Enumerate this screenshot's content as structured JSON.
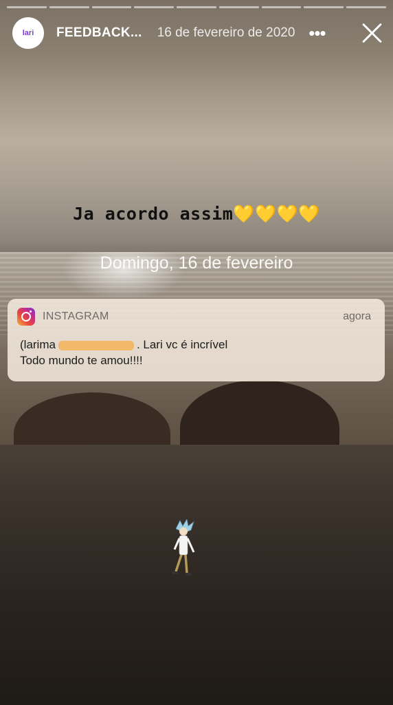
{
  "story": {
    "segments": 9,
    "username": "FEEDBACK...",
    "date": "16 de fevereiro de 2020",
    "avatar_text": "lari",
    "caption": "Ja acordo assim",
    "caption_emoji": "💛💛💛💛"
  },
  "screenshot": {
    "lock_date": "Domingo, 16 de fevereiro",
    "notification": {
      "app": "INSTAGRAM",
      "time": "agora",
      "line1_prefix": "(larima",
      "line1_suffix": ". Lari vc é incrível",
      "line2": "Todo mundo te amou!!!!"
    }
  },
  "icons": {
    "more": "more-options-icon",
    "close": "close-icon",
    "instagram": "instagram-icon",
    "sticker": "rick-sticker"
  },
  "colors": {
    "heart": "#f2c230",
    "scribble": "#f3b560"
  }
}
